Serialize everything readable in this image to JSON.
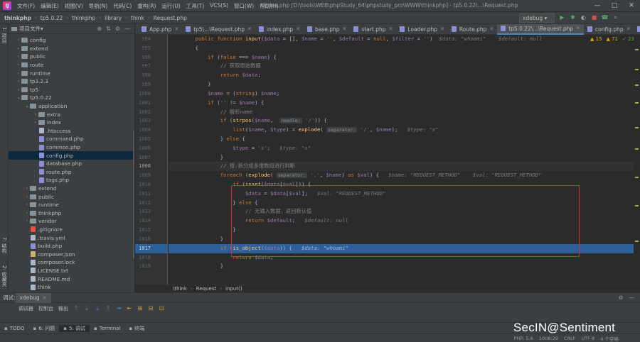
{
  "menubar": {
    "logo": "IJ",
    "items": [
      "文件(F)",
      "编辑(E)",
      "视图(V)",
      "导航(N)",
      "代码(C)",
      "重构(R)",
      "运行(U)",
      "工具(T)",
      "VCS(S)",
      "窗口(W)",
      "帮助(H)"
    ],
    "title": "index.php [D:\\tools\\WEB\\phpStudy_64\\phpstudy_pro\\WWW\\thinkphp] - tp5.0.22\\...\\Request.php",
    "min": "—",
    "max": "□",
    "close": "✕"
  },
  "navbar": {
    "crumbs": [
      "thinkphp",
      "tp5.0.22",
      "thinkphp",
      "library",
      "think",
      "Request.php"
    ],
    "run_config": "xdebug"
  },
  "left_stripe": {
    "project": "1: 项目",
    "structure": "7: 结构",
    "favorites": "2: 收藏夹"
  },
  "project": {
    "title": "项目文件",
    "rows": [
      {
        "name": "config",
        "type": "folder",
        "indent": 1,
        "arrow": "›"
      },
      {
        "name": "extend",
        "type": "folder",
        "indent": 1,
        "arrow": "›"
      },
      {
        "name": "public",
        "type": "folder",
        "indent": 1,
        "arrow": "›"
      },
      {
        "name": "route",
        "type": "folder",
        "indent": 1,
        "arrow": "›"
      },
      {
        "name": "runtime",
        "type": "folder",
        "indent": 1,
        "arrow": "›"
      },
      {
        "name": "tp3.2.3",
        "type": "folder",
        "indent": 1,
        "arrow": "›"
      },
      {
        "name": "tp5",
        "type": "folder",
        "indent": 1,
        "arrow": "›"
      },
      {
        "name": "tp5.0.22",
        "type": "folder",
        "indent": 1,
        "arrow": "⌄"
      },
      {
        "name": "application",
        "type": "folder",
        "indent": 2,
        "arrow": "⌄"
      },
      {
        "name": "extra",
        "type": "folder",
        "indent": 3,
        "arrow": "›"
      },
      {
        "name": "index",
        "type": "folder",
        "indent": 3,
        "arrow": "›"
      },
      {
        "name": ".htaccess",
        "type": "txt",
        "indent": 3,
        "arrow": ""
      },
      {
        "name": "command.php",
        "type": "php",
        "indent": 3,
        "arrow": ""
      },
      {
        "name": "common.php",
        "type": "php",
        "indent": 3,
        "arrow": ""
      },
      {
        "name": "config.php",
        "type": "php",
        "indent": 3,
        "arrow": "",
        "sel": true
      },
      {
        "name": "database.php",
        "type": "php",
        "indent": 3,
        "arrow": ""
      },
      {
        "name": "route.php",
        "type": "php",
        "indent": 3,
        "arrow": ""
      },
      {
        "name": "tags.php",
        "type": "php",
        "indent": 3,
        "arrow": ""
      },
      {
        "name": "extend",
        "type": "folder",
        "indent": 2,
        "arrow": "›"
      },
      {
        "name": "public",
        "type": "folder",
        "indent": 2,
        "arrow": "›"
      },
      {
        "name": "runtime",
        "type": "folder",
        "indent": 2,
        "arrow": "›"
      },
      {
        "name": "thinkphp",
        "type": "folder",
        "indent": 2,
        "arrow": "›"
      },
      {
        "name": "vendor",
        "type": "folder",
        "indent": 2,
        "arrow": "›"
      },
      {
        "name": ".gitignore",
        "type": "git",
        "indent": 2,
        "arrow": ""
      },
      {
        "name": ".travis.yml",
        "type": "txt",
        "indent": 2,
        "arrow": ""
      },
      {
        "name": "build.php",
        "type": "php",
        "indent": 2,
        "arrow": ""
      },
      {
        "name": "composer.json",
        "type": "json",
        "indent": 2,
        "arrow": ""
      },
      {
        "name": "composer.lock",
        "type": "txt",
        "indent": 2,
        "arrow": ""
      },
      {
        "name": "LICENSE.txt",
        "type": "txt",
        "indent": 2,
        "arrow": ""
      },
      {
        "name": "README.md",
        "type": "txt",
        "indent": 2,
        "arrow": ""
      },
      {
        "name": "think",
        "type": "txt",
        "indent": 2,
        "arrow": ""
      }
    ]
  },
  "tabs": [
    {
      "label": "App.php",
      "active": false
    },
    {
      "label": "tp5\\...\\Request.php",
      "active": false
    },
    {
      "label": "index.php",
      "active": false
    },
    {
      "label": "base.php",
      "active": false
    },
    {
      "label": "start.php",
      "active": false
    },
    {
      "label": "Loader.php",
      "active": false
    },
    {
      "label": "Route.php",
      "active": false
    },
    {
      "label": "tp5.0.22\\...\\Request.php",
      "active": true
    },
    {
      "label": "config.php",
      "active": false
    },
    {
      "label": "Co",
      "active": false
    }
  ],
  "inspections": {
    "warn": "▲ 15",
    "weak": "▲ 71",
    "ok": "✓ 23"
  },
  "line_numbers": [
    "994",
    "995",
    "996",
    "997",
    "998",
    "999",
    "1000",
    "1001",
    "1002",
    "1003",
    "1004",
    "1005",
    "1006",
    "1007",
    "1008",
    "1009",
    "1010",
    "1011",
    "1012",
    "1013",
    "1014",
    "1015",
    "1016",
    "1017",
    "1018",
    "1019"
  ],
  "current_line": "1008",
  "exec_line": "1017",
  "editor_breadcrumb": [
    "\\think",
    "Request",
    "input()"
  ],
  "debug": {
    "label": "调试:",
    "session": "xdebug",
    "tabs": [
      "调试器",
      "控制台",
      "输出"
    ],
    "icons": [
      "⇡",
      "⇣",
      "⤓",
      "⤒",
      "⇥",
      "⇤",
      "⊞",
      "⊟",
      "⊡"
    ]
  },
  "bottom_tabs": [
    "TODO",
    "6: 问题",
    "5: 调试",
    "Terminal",
    "终端"
  ],
  "status": {
    "php": "PHP: 5.6",
    "pos": "1008:29",
    "crlf": "CRLF",
    "enc": "UTF-8",
    "indent": "4 个空格"
  },
  "watermark": "SecIN@Sentiment"
}
